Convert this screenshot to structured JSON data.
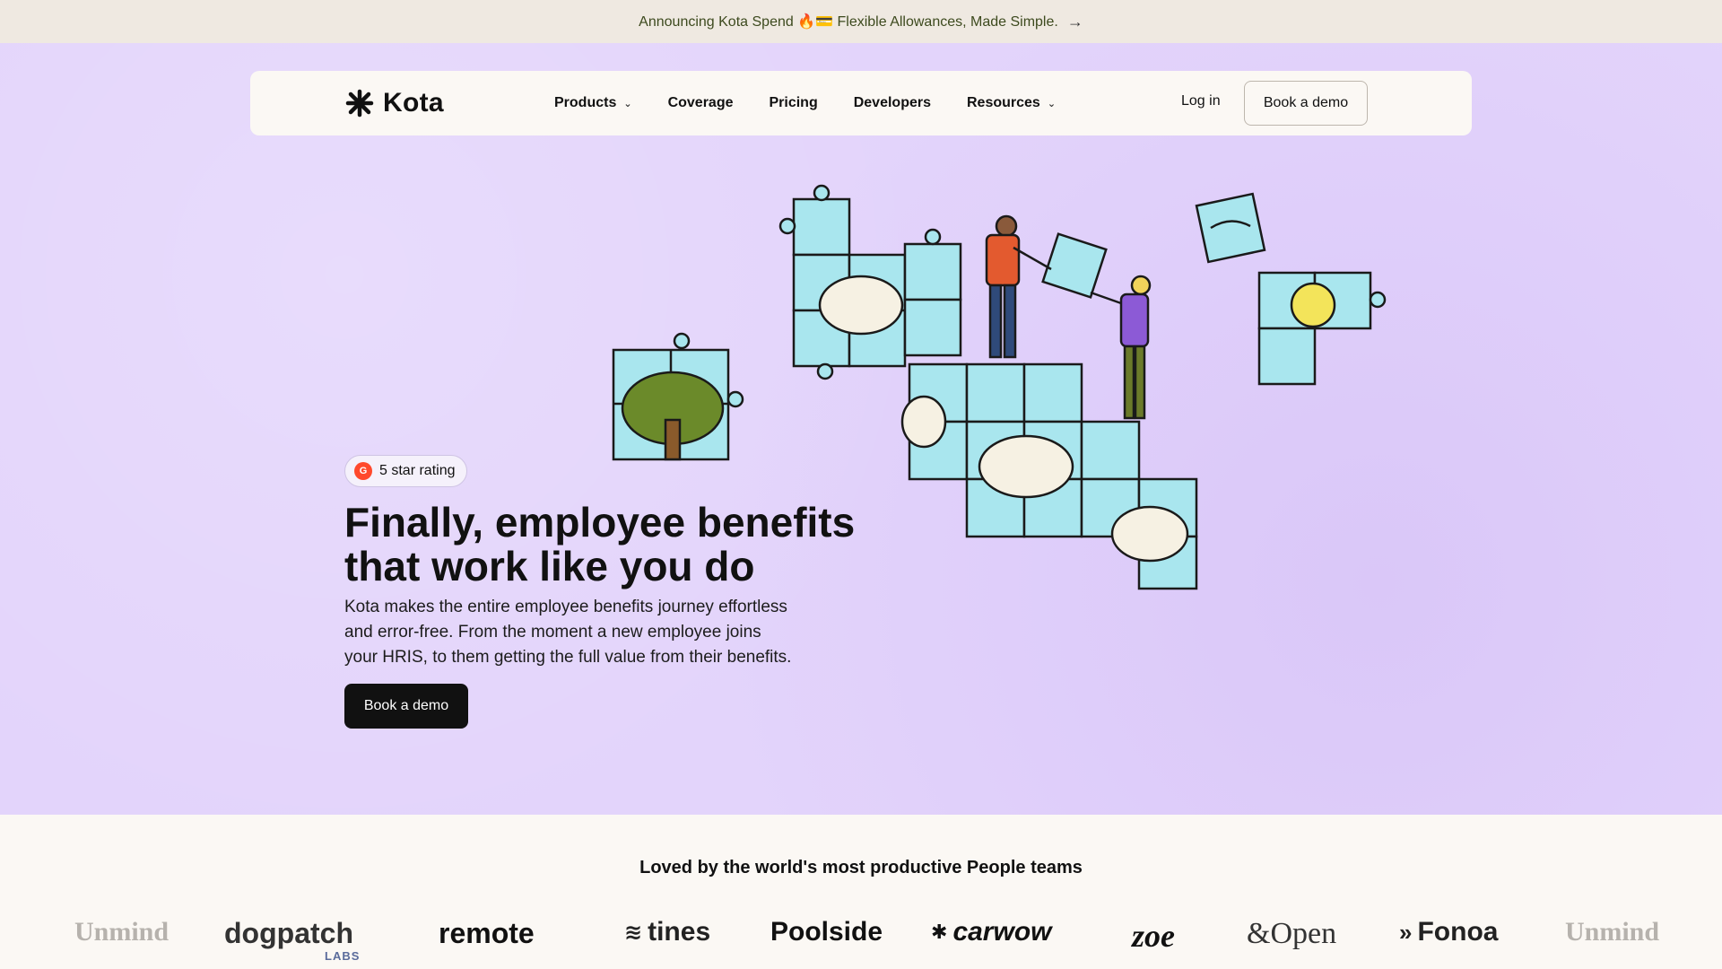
{
  "announcement": {
    "text": "Announcing Kota Spend 🔥💳 Flexible Allowances, Made Simple.",
    "arrow_icon": "arrow-right-icon"
  },
  "nav": {
    "brand": "Kota",
    "items": [
      {
        "label": "Products",
        "has_dropdown": true
      },
      {
        "label": "Coverage",
        "has_dropdown": false
      },
      {
        "label": "Pricing",
        "has_dropdown": false
      },
      {
        "label": "Developers",
        "has_dropdown": false
      },
      {
        "label": "Resources",
        "has_dropdown": true
      }
    ],
    "login": "Log in",
    "cta": "Book a demo"
  },
  "hero": {
    "badge": "5 star rating",
    "badge_icon": "G",
    "headline_lines": [
      "Finally, employee benefits",
      "that work like you do"
    ],
    "subtext_lines": [
      "Kota makes the entire employee benefits journey effortless",
      "and error-free. From the moment a new employee joins",
      "your HRIS, to them getting the full value from their benefits."
    ],
    "cta": "Book a demo"
  },
  "social_proof": {
    "heading": "Loved by the world's most productive People teams",
    "logos": [
      "Unmind",
      "dogpatch",
      "LABS",
      "remote",
      "tines",
      "Poolside",
      "carwow",
      "zoe",
      "&Open",
      "Fonoa",
      "Unmind"
    ]
  },
  "colors": {
    "hero_bg": "#e3d4fb",
    "puzzle": "#a9e6ee",
    "nav_bg": "#fbf8f4",
    "cta_bg": "#111111"
  }
}
